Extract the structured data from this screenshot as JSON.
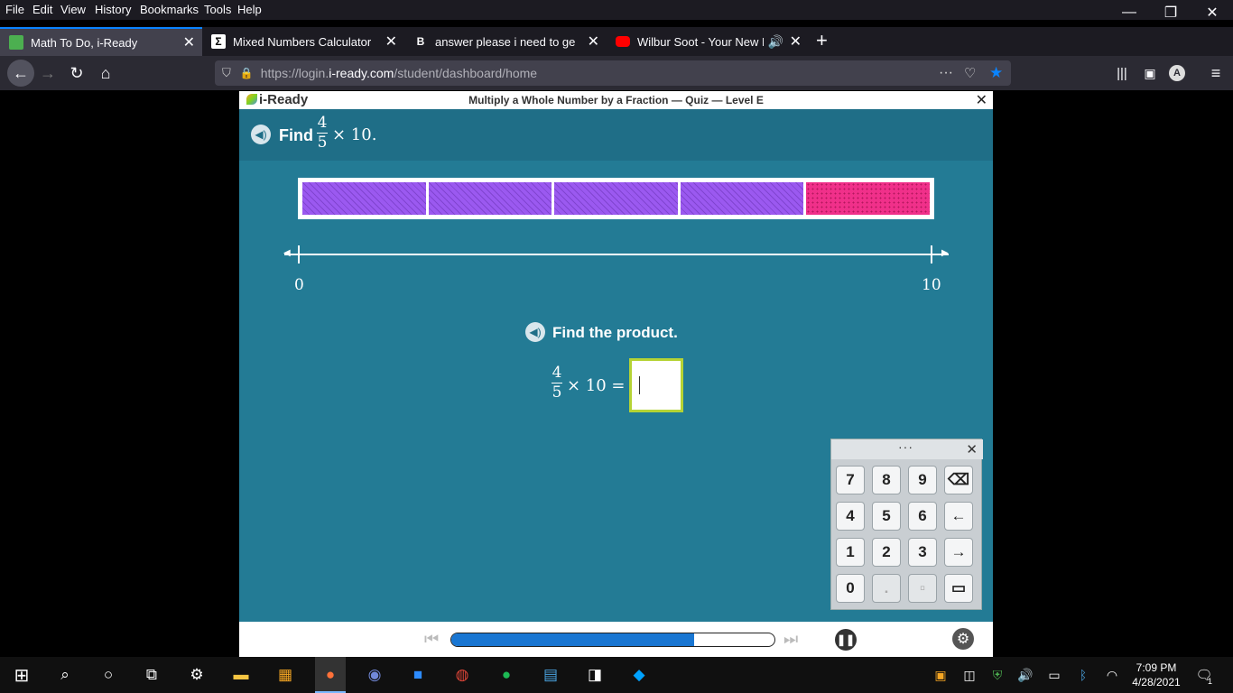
{
  "menubar": {
    "items": [
      "File",
      "Edit",
      "View",
      "History",
      "Bookmarks",
      "Tools",
      "Help"
    ]
  },
  "tabs": [
    {
      "title": "Math To Do, i-Ready",
      "favicon_color": "#4caf50"
    },
    {
      "title": "Mixed Numbers Calculator",
      "favicon_color": "#ffffff"
    },
    {
      "title": "answer please i need to get a al",
      "favicon_color": "#ffffff"
    },
    {
      "title": "Wilbur Soot - Your New Boy",
      "favicon_color": "#ff0000"
    }
  ],
  "url": {
    "prefix": "https://login.",
    "domain": "i-ready.com",
    "path": "/student/dashboard/home"
  },
  "app": {
    "logo": "i-Ready",
    "title": "Multiply a Whole Number by a Fraction — Quiz — Level E",
    "question": {
      "find_label": "Find",
      "numerator": "4",
      "denominator": "5",
      "times_text": "× 10."
    },
    "tape_diagram": {
      "total_parts": 5,
      "shaded_parts": 4,
      "shaded_color": "#9b59f0",
      "unshaded_color": "#f0308a"
    },
    "number_line": {
      "start_label": "0",
      "end_label": "10"
    },
    "prompt": "Find the product.",
    "equation": {
      "numerator": "4",
      "denominator": "5",
      "rest": "× 10 ="
    },
    "answer_value": "",
    "keypad": {
      "dots": "···",
      "close": "✕",
      "keys": [
        "7",
        "8",
        "9",
        "⌫",
        "4",
        "5",
        "6",
        "←",
        "1",
        "2",
        "3",
        "→",
        "0",
        ".",
        "▫",
        "▭"
      ]
    },
    "progress_fraction": 0.75
  },
  "taskbar": {
    "time": "7:09 PM",
    "date": "4/28/2021",
    "notification_count": "1"
  }
}
